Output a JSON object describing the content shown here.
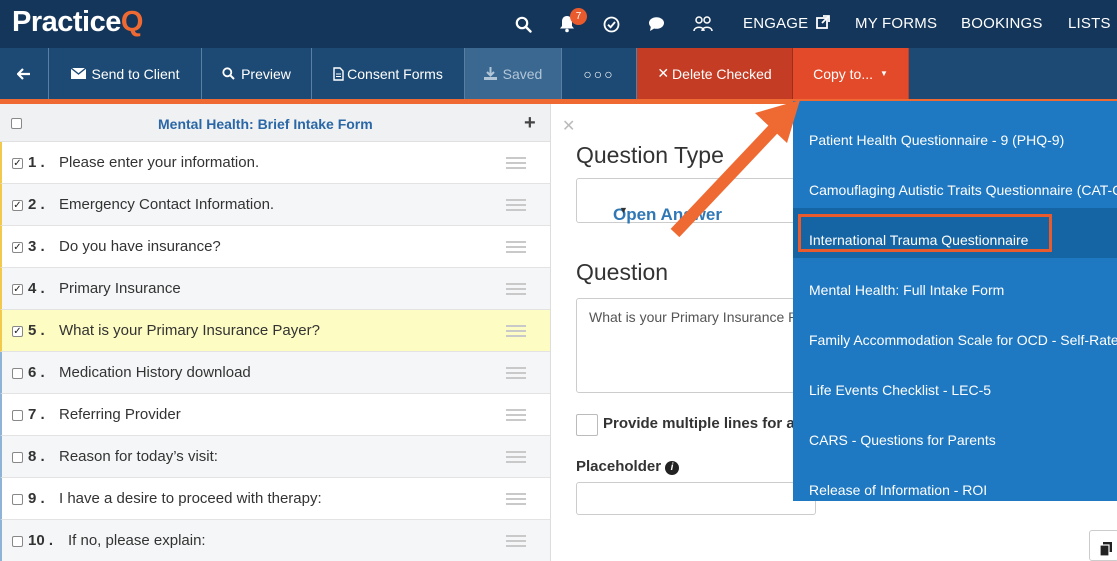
{
  "nav": {
    "logo_main": "Practice",
    "logo_accent": "Q",
    "notification_count": "7",
    "engage": "ENGAGE",
    "my_forms": "MY FORMS",
    "bookings": "BOOKINGS",
    "lists": "LISTS"
  },
  "toolbar": {
    "send_to_client": "Send to Client",
    "preview": "Preview",
    "consent_forms": "Consent Forms",
    "saved": "Saved",
    "more": "○○○",
    "delete_checked": "Delete Checked",
    "copy_to": "Copy to..."
  },
  "form": {
    "title": "Mental Health: Brief Intake Form",
    "questions": [
      {
        "num": "1 .",
        "text": "Please enter your information.",
        "checked": true
      },
      {
        "num": "2 .",
        "text": "Emergency Contact Information.",
        "checked": true
      },
      {
        "num": "3 .",
        "text": "Do you have insurance?",
        "checked": true
      },
      {
        "num": "4 .",
        "text": "Primary Insurance",
        "checked": true
      },
      {
        "num": "5 .",
        "text": "What is your Primary Insurance Payer?",
        "checked": true
      },
      {
        "num": "6 .",
        "text": "Medication History download",
        "checked": false
      },
      {
        "num": "7 .",
        "text": "Referring Provider",
        "checked": false
      },
      {
        "num": "8 .",
        "text": "Reason for today’s visit:",
        "checked": false
      },
      {
        "num": "9 .",
        "text": "I have a desire to proceed with therapy:",
        "checked": false
      },
      {
        "num": "10 .",
        "text": "If no, please explain:",
        "checked": false
      }
    ]
  },
  "editor": {
    "question_type_heading": "Question Type",
    "question_type_value": "Open Answer",
    "question_heading": "Question",
    "question_value": "What is your Primary Insurance Payer?",
    "multiple_lines_label": "Provide multiple lines for answer",
    "placeholder_label": "Placeholder"
  },
  "copy_dropdown": {
    "items": [
      "Patient Health Questionnaire - 9 (PHQ-9)",
      "Camouflaging Autistic Traits Questionnaire (CAT-Q)",
      "International Trauma Questionnaire",
      "Mental Health: Full Intake Form",
      "Family Accommodation Scale for OCD - Self-Rated",
      "Life Events Checklist - LEC-5",
      "CARS - Questions for Parents",
      "Release of Information - ROI"
    ],
    "selected": "International Trauma Questionnaire"
  },
  "colors": {
    "nav_bg": "#14365a",
    "toolbar_bg": "#1d4a74",
    "accent_orange": "#ef6a32",
    "dropdown_bg": "#1e78c2",
    "link_blue": "#2a67a6"
  }
}
